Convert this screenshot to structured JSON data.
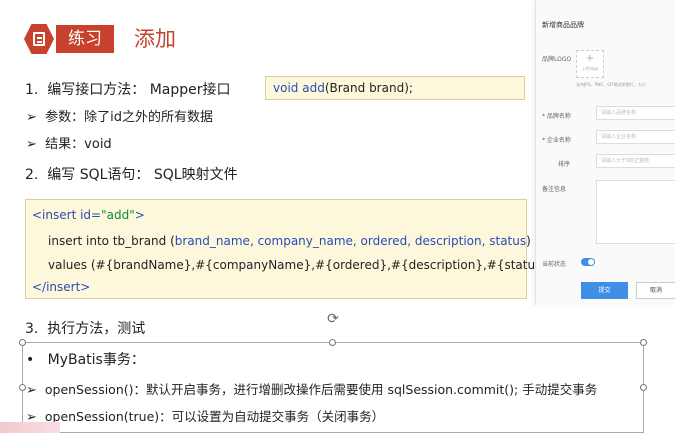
{
  "header": {
    "tag": "练习",
    "title": "添加"
  },
  "steps": [
    {
      "num": "1.",
      "text": "编写接口方法：  Mapper接口"
    },
    {
      "num": "2.",
      "text": "编写 SQL语句：  SQL映射文件"
    },
    {
      "num": "3.",
      "text": "执行方法，测试"
    }
  ],
  "sub1": [
    {
      "text": "参数：除了id之外的所有数据"
    },
    {
      "text": "结果：void"
    }
  ],
  "code1": {
    "kw": "void",
    "fn": "add",
    "rest": "(Brand brand);"
  },
  "code2": {
    "line1_open": "<insert ",
    "line1_attr": "id=",
    "line1_val": "\"add\"",
    "line1_close": ">",
    "line2_a": "insert into tb_brand (",
    "line2_fields": "brand_name, company_name, ordered, description, status",
    "line2_b": ")",
    "line3": "values (#{brandName},#{companyName},#{ordered},#{description},#{status});",
    "line4": "</insert>"
  },
  "mybatis": {
    "title": "MyBatis事务：",
    "items": [
      {
        "text": "openSession()：默认开启事务，进行增删改操作后需要使用 sqlSession.commit(); 手动提交事务"
      },
      {
        "text": "openSession(true)：可以设置为自动提交事务（关闭事务）"
      }
    ]
  },
  "panel": {
    "title": "新增商品品牌",
    "logo_label": "品牌LOGO",
    "upload_plus": "+",
    "upload_text": "上传logo",
    "upload_hint": "支持JPG、PNG、GIF格式的图片，大小",
    "brand_name_label": "* 品牌名称",
    "brand_name_placeholder": "请输入品牌名称",
    "company_label": "* 企业名称",
    "company_placeholder": "请输入企业名称",
    "order_label": "排序",
    "order_placeholder": "请输入大于0的正整数",
    "desc_label": "备注信息",
    "status_label": "当前状态",
    "submit": "提交",
    "cancel": "取消"
  }
}
